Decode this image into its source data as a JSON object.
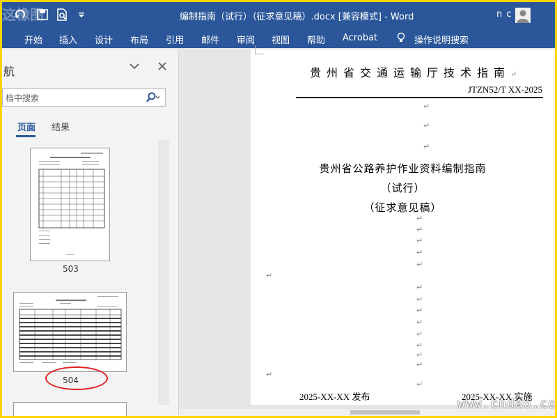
{
  "window": {
    "title": "编制指南（试行）（征求意见稿）.docx [兼容模式]  -  Word",
    "user": "n c",
    "watermark_top_left": "这橡图",
    "watermark_bottom_right": "www.cndao.com"
  },
  "ribbon": {
    "tabs": [
      "开始",
      "插入",
      "设计",
      "布局",
      "引用",
      "邮件",
      "审阅",
      "视图",
      "帮助",
      "Acrobat"
    ],
    "tell_me": "操作说明搜索"
  },
  "nav_pane": {
    "title": "航",
    "search_placeholder": "档中搜索",
    "tabs": [
      "页面",
      "结果"
    ],
    "pages": [
      {
        "number": "503"
      },
      {
        "number": "504"
      }
    ]
  },
  "document": {
    "header": "贵州省交通运输厅技术指南",
    "code": "JTZN52/T XX-2025",
    "title": "贵州省公路养护作业资料编制指南",
    "subtitle1": "（试行）",
    "subtitle2": "（征求意见稿）",
    "publish": "2025-XX-XX 发布",
    "implement": "2025-XX-XX 实施",
    "para_mark": "↵"
  },
  "colors": {
    "accent": "#2b579a",
    "border": "#ffd400",
    "highlight_circle": "#e02020"
  }
}
